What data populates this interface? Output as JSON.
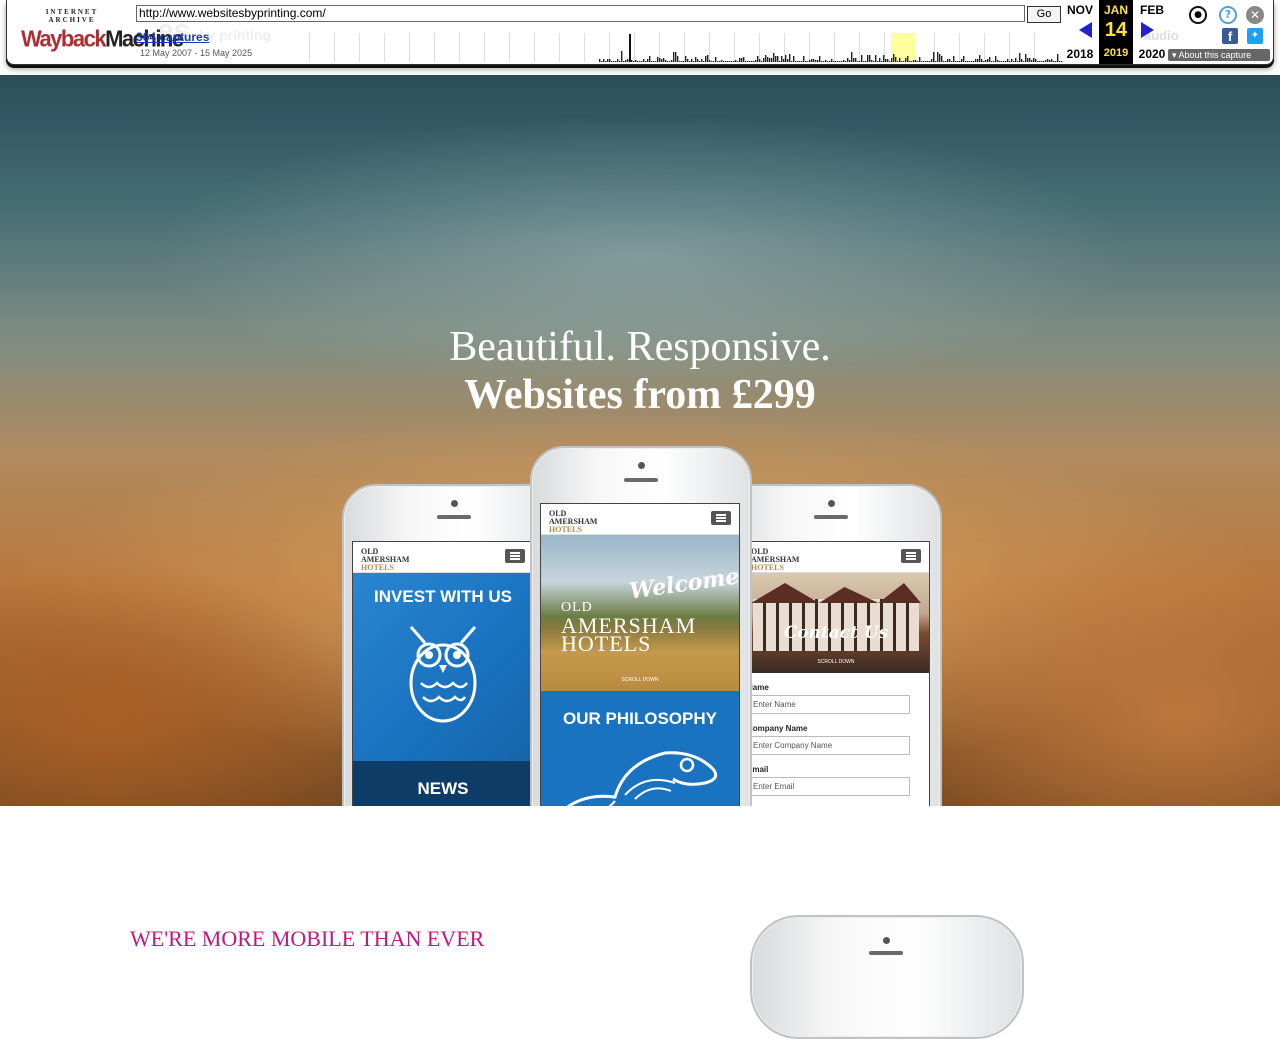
{
  "wayback": {
    "logo_top": "INTERNET ARCHIVE",
    "logo_wayback": "Wayback",
    "logo_machine": "Machine",
    "url": "http://www.websitesbyprinting.com/",
    "go_label": "Go",
    "captures_label": "364 captures",
    "capture_range": "12 May 2007 - 15 May 2025",
    "prev_month": "NOV",
    "prev_year": "2018",
    "current_month": "JAN",
    "current_day": "14",
    "current_year": "2019",
    "next_month": "FEB",
    "next_year": "2020",
    "about_label": "About this capture",
    "icons": [
      "user-icon",
      "help-icon",
      "close-icon",
      "facebook-icon",
      "twitter-icon",
      "prev-arrow-icon",
      "next-arrow-icon"
    ]
  },
  "hero": {
    "subtitle": "Beautiful. Responsive.",
    "title": "Websites from £299"
  },
  "phones": {
    "left": {
      "logo_line1": "OLD",
      "logo_line2": "AMERSHAM",
      "logo_line3": "HOTELS",
      "panel1": "INVEST WITH US",
      "panel2": "NEWS"
    },
    "center": {
      "logo_line1": "OLD",
      "logo_line2": "AMERSHAM",
      "logo_line3": "HOTELS",
      "hero_welcome": "Welcome",
      "hero_title_line1": "OLD",
      "hero_title_line2": "AMERSHAM",
      "hero_title_line3": "HOTELS",
      "scroll": "SCROLL DOWN",
      "panel": "OUR PHILOSOPHY"
    },
    "right": {
      "logo_line1": "OLD",
      "logo_line2": "AMERSHAM",
      "logo_line3": "HOTELS",
      "hero_title": "Contact Us",
      "scroll": "SCROLL DOWN",
      "form": [
        {
          "label": "Name",
          "placeholder": "Enter Name"
        },
        {
          "label": "Company Name",
          "placeholder": "Enter Company Name"
        },
        {
          "label": "Email",
          "placeholder": "Enter Email"
        }
      ]
    }
  },
  "section": {
    "heading": "WE'RE MORE MOBILE THAN EVER"
  },
  "colors": {
    "heading_pink": "#c2187e",
    "wayback_red": "#ab2e33",
    "panel_blue": "#1a73c0",
    "panel_navy": "#0d3d66"
  }
}
